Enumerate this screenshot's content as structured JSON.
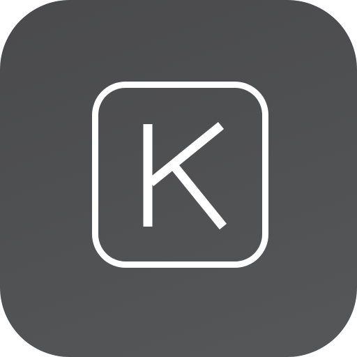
{
  "icon": {
    "glyph_label": "K",
    "glyph_icon": "letter-k-key-icon",
    "background_color": "#505153",
    "foreground_color": "#ffffff"
  }
}
